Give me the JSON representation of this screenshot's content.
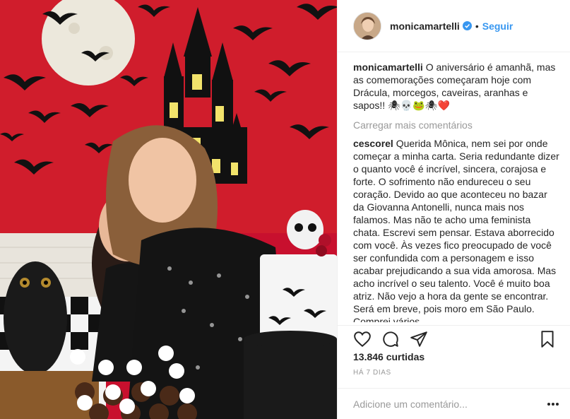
{
  "post": {
    "image_alt": "photo"
  },
  "header": {
    "username": "monicamartelli",
    "separator": "•",
    "follow_label": "Seguir"
  },
  "caption": {
    "username": "monicamartelli",
    "text": "O aniversário é amanhã, mas as comemorações começaram hoje com Drácula, morcegos, caveiras, aranhas e sapos!! 🕷💀🐸🕷❤️"
  },
  "load_more_label": "Carregar mais comentários",
  "comment": {
    "username": "cescorel",
    "text": "Querida Mônica, nem sei por onde começar a minha carta. Seria redundante dizer o quanto você é incrível, sincera, corajosa e forte. O sofrimento não endureceu o seu coração. Devido ao que aconteceu no bazar da Giovanna Antonelli, nunca mais nos falamos. Mas não te acho uma feminista chata. Escrevi sem pensar. Estava aborrecido com você. Às vezes fico preocupado de você ser confundida com a personagem e isso acabar prejudicando a sua vida amorosa. Mas acho incrível o seu talento. Você é muito boa atriz. Não vejo a hora da gente se encontrar. Será em breve, pois moro em São Paulo. Comprei vários"
  },
  "actions": {
    "like_icon": "heart-icon",
    "comment_icon": "comment-icon",
    "share_icon": "share-icon",
    "save_icon": "bookmark-icon"
  },
  "likes_text": "13.846 curtidas",
  "date_text": "HÁ 7 DIAS",
  "add_comment": {
    "placeholder": "Adicione um comentário...",
    "more_icon": "more-options-icon"
  },
  "colors": {
    "follow": "#3897f0",
    "verified": "#3897f0",
    "muted": "#999999",
    "text": "#262626",
    "photo_background": "#c8102e"
  }
}
